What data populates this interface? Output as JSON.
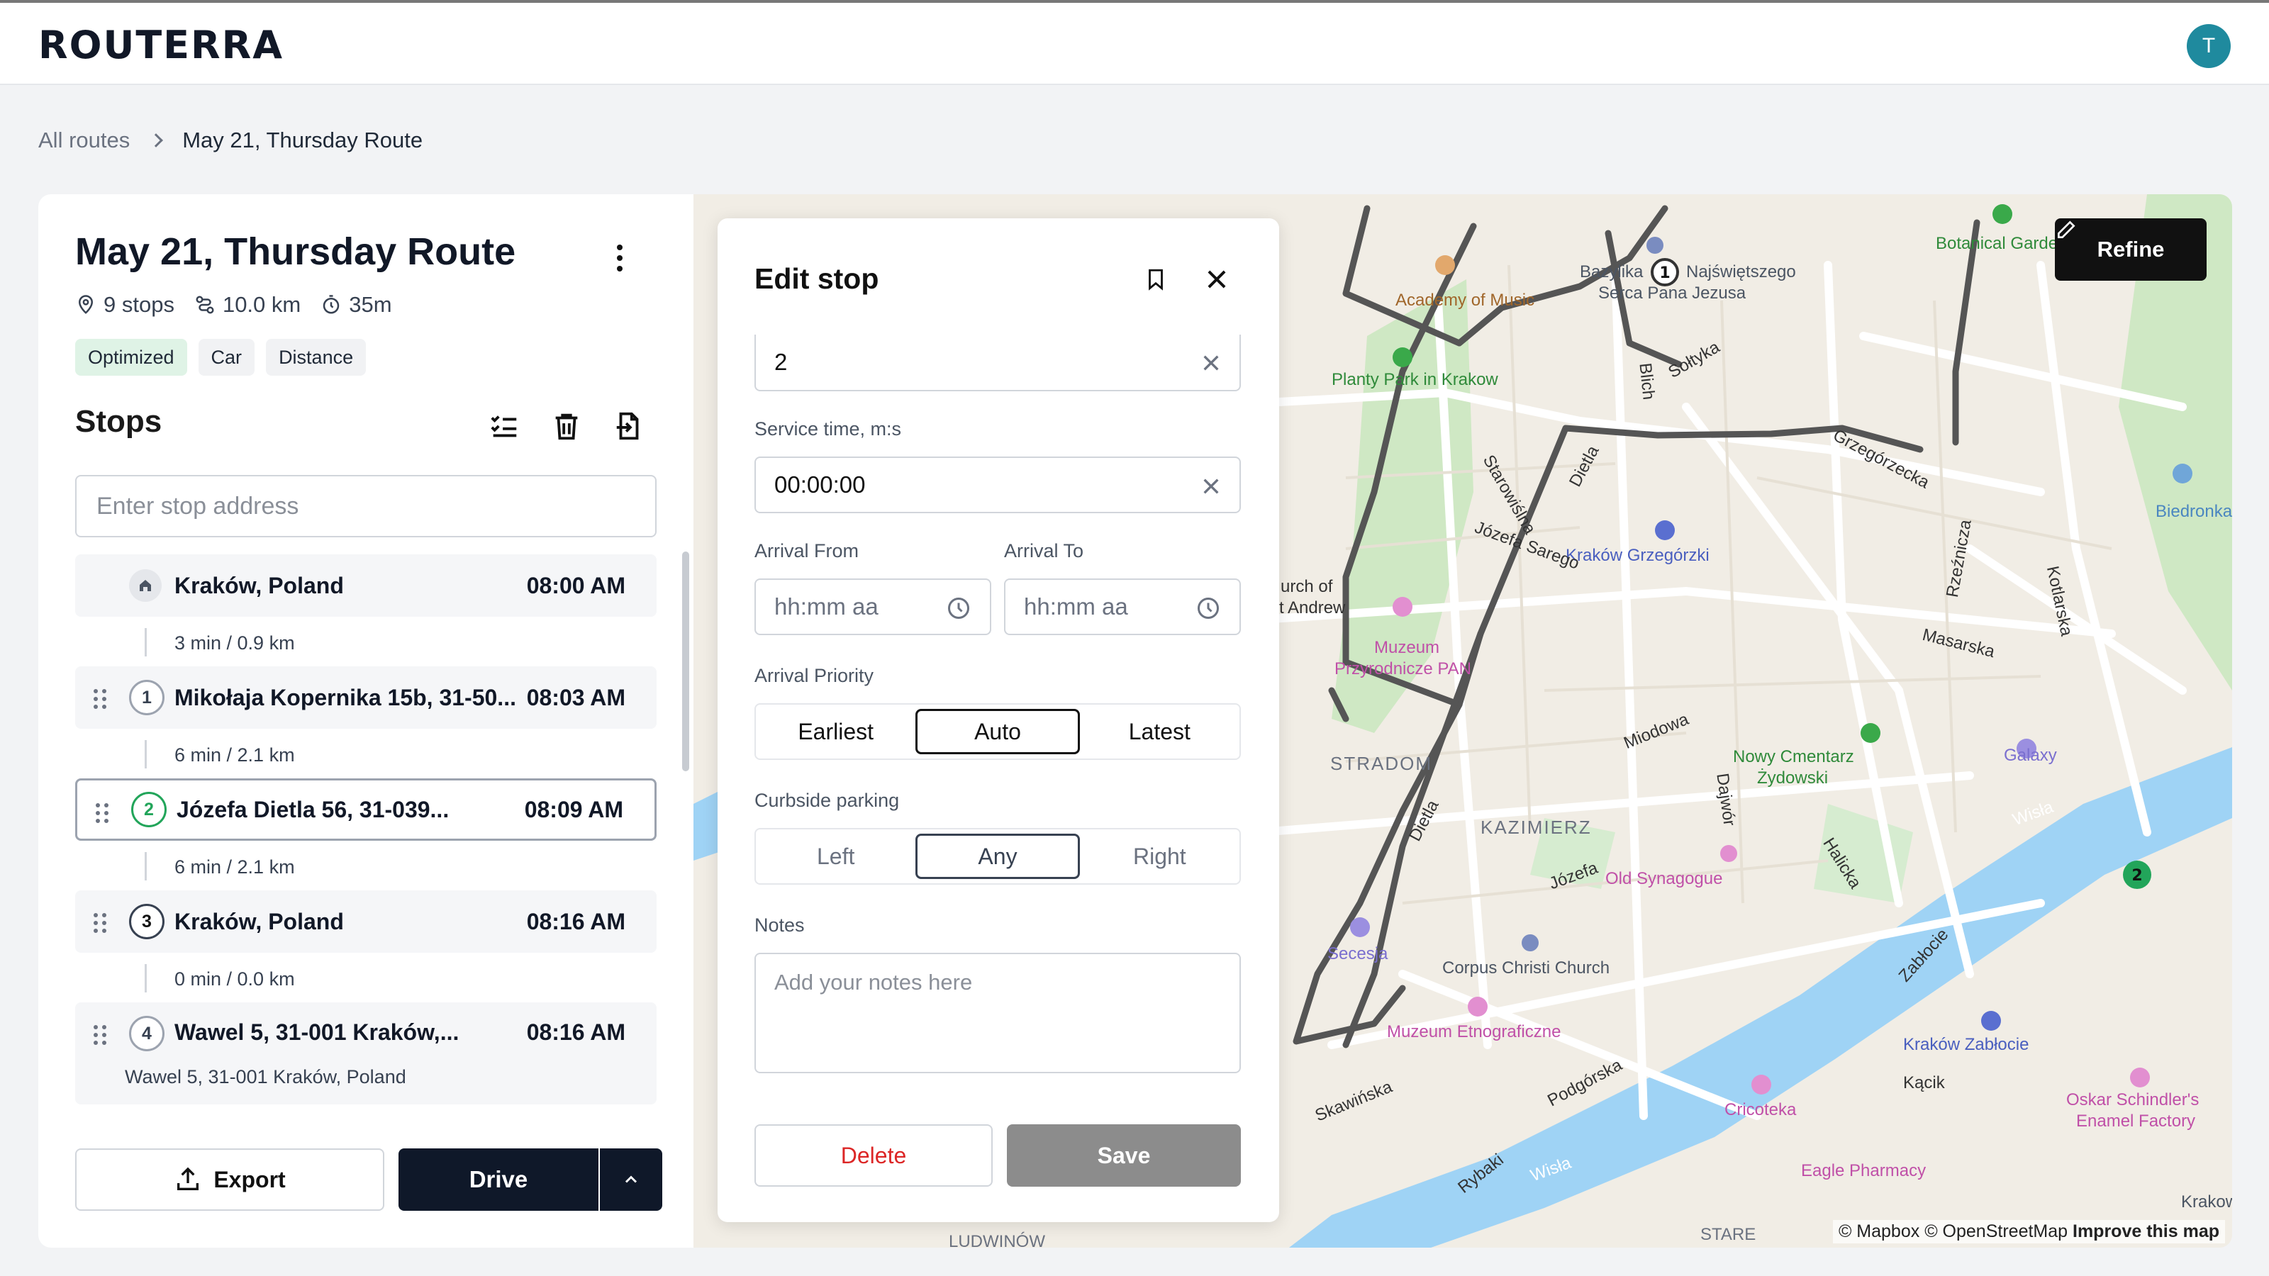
{
  "app": {
    "logo": "ROUTERRA",
    "avatar_initial": "T"
  },
  "breadcrumb": {
    "parent": "All routes",
    "current": "May 21, Thursday Route"
  },
  "route": {
    "title": "May 21, Thursday Route",
    "stops_count": "9 stops",
    "distance": "10.0 km",
    "duration": "35m",
    "chips": [
      "Optimized",
      "Car",
      "Distance"
    ]
  },
  "stops_panel": {
    "title": "Stops",
    "address_placeholder": "Enter stop address",
    "items": [
      {
        "badge": "home",
        "name": "Kraków, Poland",
        "time": "08:00 AM",
        "leg": "3 min / 0.9 km"
      },
      {
        "badge": "1",
        "name": "Mikołaja Kopernika 15b, 31-50...",
        "time": "08:03 AM",
        "leg": "6 min / 2.1 km"
      },
      {
        "badge": "2",
        "name": "Józefa Dietla 56, 31-039...",
        "time": "08:09 AM",
        "leg": "6 min / 2.1 km"
      },
      {
        "badge": "3",
        "name": "Kraków, Poland",
        "time": "08:16 AM",
        "leg": "0 min / 0.0 km"
      },
      {
        "badge": "4",
        "name": "Wawel 5, 31-001 Kraków,...",
        "time": "08:16 AM",
        "sub": "Wawel 5, 31-001 Kraków, Poland"
      }
    ],
    "export_label": "Export",
    "drive_label": "Drive"
  },
  "edit_stop": {
    "title": "Edit stop",
    "stop_number_value": "2",
    "service_time_label": "Service time, m:s",
    "service_time_value": "00:00:00",
    "arrival_from_label": "Arrival From",
    "arrival_to_label": "Arrival To",
    "time_placeholder": "hh:mm aa",
    "arrival_priority_label": "Arrival Priority",
    "arrival_priority_options": [
      "Earliest",
      "Auto",
      "Latest"
    ],
    "arrival_priority_selected": "Auto",
    "curbside_label": "Curbside parking",
    "curbside_options": [
      "Left",
      "Any",
      "Right"
    ],
    "curbside_selected": "Any",
    "notes_label": "Notes",
    "notes_placeholder": "Add your notes here",
    "delete_label": "Delete",
    "save_label": "Save"
  },
  "map": {
    "refine_label": "Refine",
    "attribution": "© Mapbox © OpenStreetMap",
    "improve_link": "Improve this map",
    "markers": [
      "1",
      "2"
    ],
    "labels": {
      "botanical": "Botanical Garden",
      "bazylika": "Bazylika",
      "swietszego": "Najświętszego",
      "serca": "Serca Pana Jezusa",
      "academy": "Academy of Music",
      "planty": "Planty Park in Krakow",
      "grzegorzecka": "Grzegórzecka",
      "krakow_grzegorzki": "Kraków Grzegórzki",
      "biedronka": "Biedronka",
      "muzeum": "Muzeum",
      "przyrodnicze": "Przyrodnicze PAN",
      "stradom": "STRADOM",
      "kazimierz": "KAZIMIERZ",
      "nowy_cmentarz": "Nowy Cmentarz",
      "zydowski": "Żydowski",
      "galaxy": "Galaxy",
      "old_synagogue": "Old Synagogue",
      "secesja": "Secesja",
      "corpus": "Corpus Christi Church",
      "muzeum_etno": "Muzeum Etnograficzne",
      "krakow_zablocie": "Kraków Zabłocie",
      "cricoteka": "Cricoteka",
      "oskar": "Oskar Schindler's",
      "enamel": "Enamel Factory",
      "eagle": "Eagle Pharmacy",
      "wisla": "Wisła",
      "ludwinow": "LUDWINÓW",
      "stare": "STARE",
      "dietla": "Dietla",
      "miodowa": "Miodowa",
      "starowislna": "Starowiślna",
      "podgorska": "Podgórska",
      "zablocie": "Zabłocie",
      "kotlarska": "Kotlarska",
      "masarska": "Masarska",
      "rzeznicza": "Rzeźnicza",
      "halicka": "Halicka",
      "dajwor": "Dajwór",
      "sarego": "Józefa Sarego",
      "jozefa": "Józefa",
      "skawinska": "Skawińska",
      "rybaki": "Rybaki",
      "kacik": "Kącik",
      "blich": "Blich",
      "soltyka": "Sołtyka",
      "church_of": "urch of",
      "andrew": "t Andrew",
      "krakows": "Krakows"
    }
  }
}
